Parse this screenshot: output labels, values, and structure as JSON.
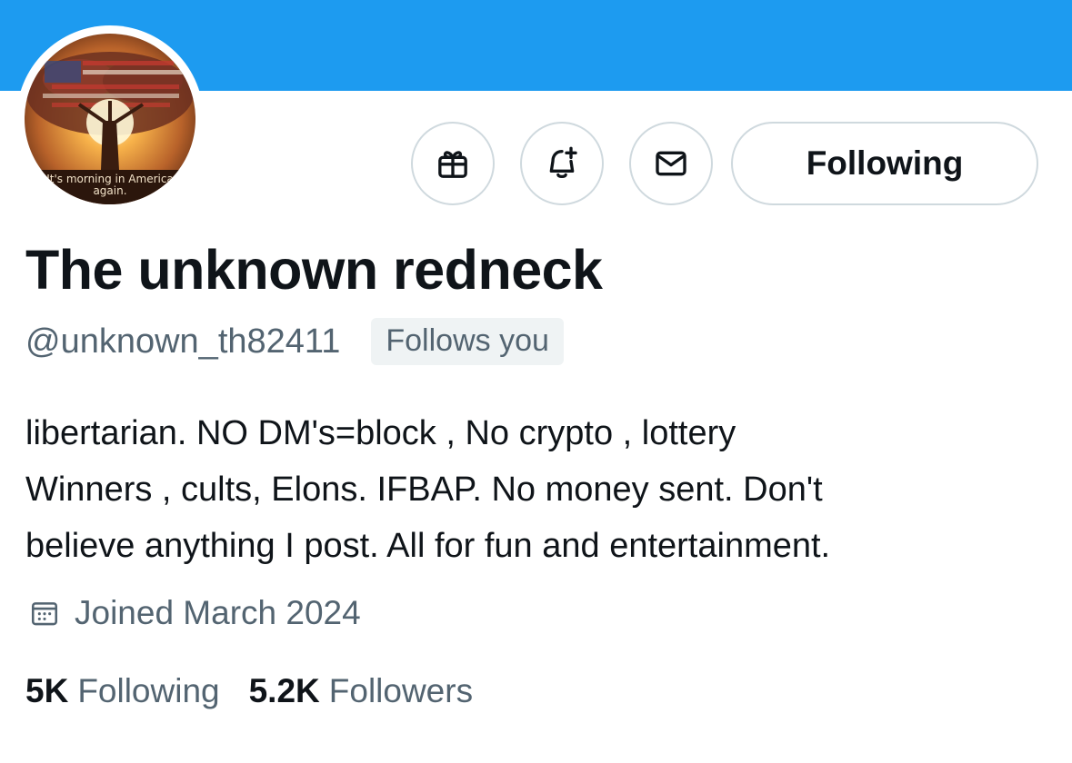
{
  "profile": {
    "avatar_caption_line1": "It's morning in America",
    "avatar_caption_line2": "again.",
    "display_name": "The unknown redneck",
    "handle": "@unknown_th82411",
    "follows_you_badge": "Follows you",
    "bio_lines": [
      "libertarian. NO DM's=block , No crypto , lottery",
      "Winners , cults, Elons. IFBAP. No money sent. Don't",
      "believe anything I post. All for fun and entertainment."
    ],
    "joined": "Joined March 2024",
    "following_count": "5K",
    "following_label": "Following",
    "followers_count": "5.2K",
    "followers_label": "Followers"
  },
  "actions": {
    "following_button_label": "Following",
    "icons": [
      "gift-icon",
      "notification-bell-plus-icon",
      "message-envelope-icon"
    ]
  },
  "colors": {
    "banner": "#1d9bf0",
    "text_primary": "#0f1419",
    "text_secondary": "#536471",
    "border": "#cfd9de",
    "badge_bg": "#eff3f4"
  }
}
